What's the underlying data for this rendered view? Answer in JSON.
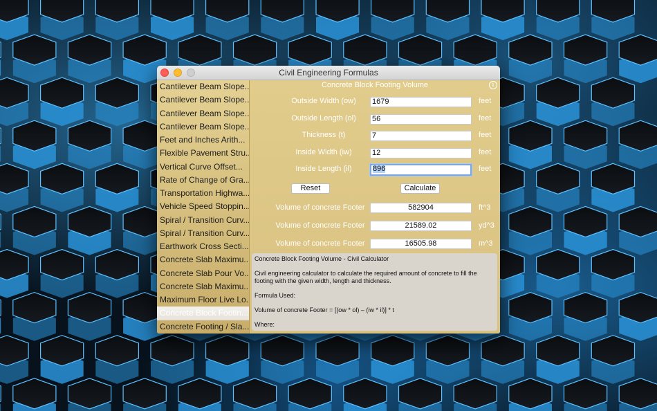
{
  "window": {
    "title": "Civil Engineering Formulas"
  },
  "sidebar": {
    "items": [
      {
        "label": "Cantilever Beam Slope..."
      },
      {
        "label": "Cantilever Beam Slope..."
      },
      {
        "label": "Cantilever Beam Slope..."
      },
      {
        "label": "Cantilever Beam Slope..."
      },
      {
        "label": "Feet and Inches Arith..."
      },
      {
        "label": "Flexible Pavement Stru..."
      },
      {
        "label": "Vertical Curve Offset..."
      },
      {
        "label": "Rate of Change of Gra..."
      },
      {
        "label": "Transportation Highwa..."
      },
      {
        "label": "Vehicle Speed Stoppin..."
      },
      {
        "label": "Spiral / Transition Curv..."
      },
      {
        "label": "Spiral / Transition Curv..."
      },
      {
        "label": "Earthwork Cross Secti..."
      },
      {
        "label": "Concrete Slab Maximu..."
      },
      {
        "label": "Concrete Slab Pour Vo..."
      },
      {
        "label": "Concrete Slab Maximu..."
      },
      {
        "label": "Maximum Floor Live Lo..."
      },
      {
        "label": "Concrete Block Footin..."
      },
      {
        "label": "Concrete Footing / Sla..."
      }
    ],
    "selected_index": 17
  },
  "main": {
    "title": "Concrete Block Footing Volume",
    "inputs": [
      {
        "label": "Outside Width (ow)",
        "value": "1679",
        "unit": "feet"
      },
      {
        "label": "Outside Length (ol)",
        "value": "56",
        "unit": "feet"
      },
      {
        "label": "Thickness (t)",
        "value": "7",
        "unit": "feet"
      },
      {
        "label": "Inside Width (iw)",
        "value": "12",
        "unit": "feet"
      },
      {
        "label": "Inside Length (il)",
        "value": "896",
        "unit": "feet"
      }
    ],
    "reset_label": "Reset",
    "calculate_label": "Calculate",
    "results": [
      {
        "label": "Volume of concrete Footer",
        "value": "582904",
        "unit": "ft^3"
      },
      {
        "label": "Volume of concrete Footer",
        "value": "21589.02",
        "unit": "yd^3"
      },
      {
        "label": "Volume of concrete Footer",
        "value": "16505.98",
        "unit": "m^3"
      }
    ],
    "description": {
      "heading": "Concrete Block Footing Volume - Civil Calculator",
      "body": "Civil engineering calculator to calculate the required amount of concrete to fill the footing with the given width, length and thickness.",
      "formula_used": "Formula Used:",
      "formula": "Volume of concrete Footer = [(ow * ol) – (iw * il)] * t",
      "where": "Where:"
    }
  },
  "colors": {
    "window_bg": "#dcc58a",
    "sidebar_selected": "#ebe9e4",
    "desktop_glow": "#2b9be6"
  }
}
